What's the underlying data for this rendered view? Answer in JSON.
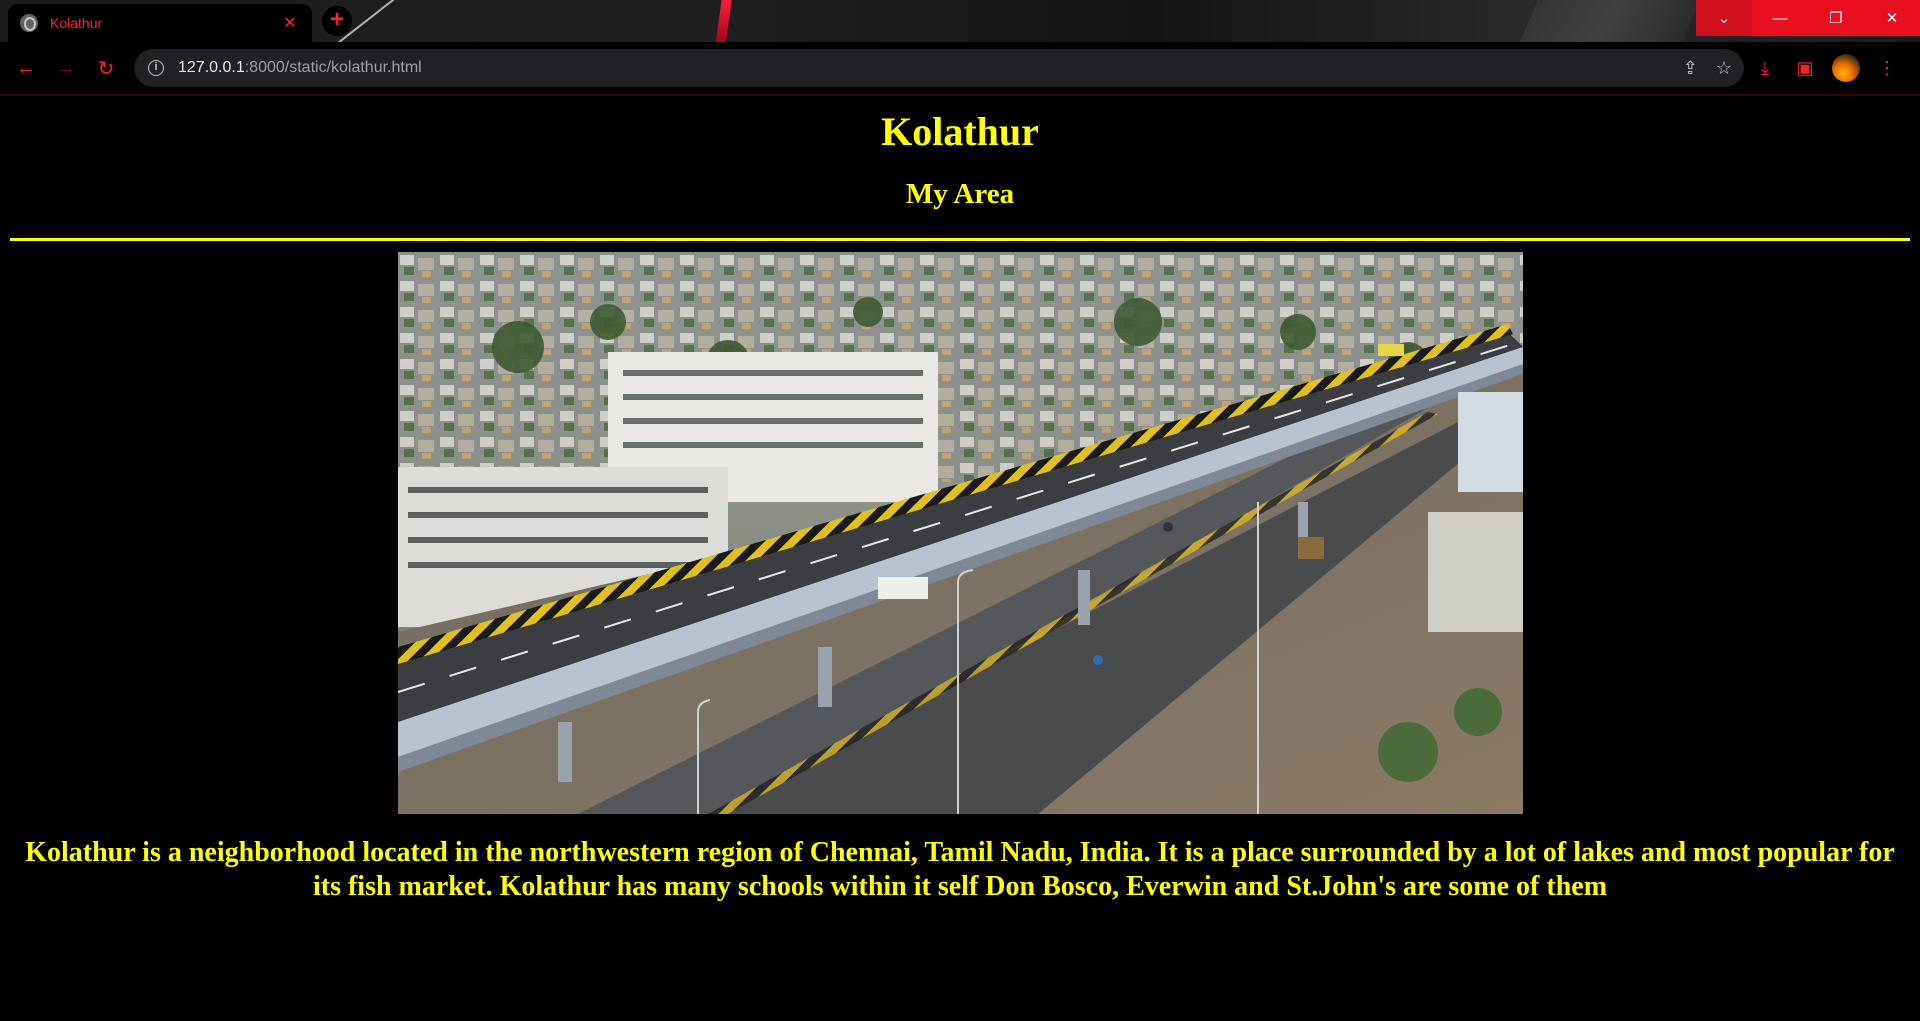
{
  "browser": {
    "tab_title": "Kolathur",
    "url_host": "127.0.0.1",
    "url_path": ":8000/static/kolathur.html"
  },
  "page": {
    "title": "Kolathur",
    "subtitle": "My Area",
    "description": "Kolathur is a neighborhood located in the northwestern region of Chennai, Tamil Nadu, India. It is a place surrounded by a lot of lakes and most popular for its fish market. Kolathur has many schools within it self Don Bosco, Everwin and St.John's are some of them"
  },
  "colors": {
    "page_background": "#000000",
    "text_accent": "#ffff00",
    "browser_accent": "#ff1e2d"
  },
  "icons": {
    "back": "arrow-left-icon",
    "forward": "arrow-right-icon",
    "reload": "reload-icon",
    "site_info": "info-icon",
    "share": "share-icon",
    "bookmark": "star-icon",
    "download": "download-icon",
    "side_panel": "side-panel-icon",
    "menu": "kebab-menu-icon"
  }
}
